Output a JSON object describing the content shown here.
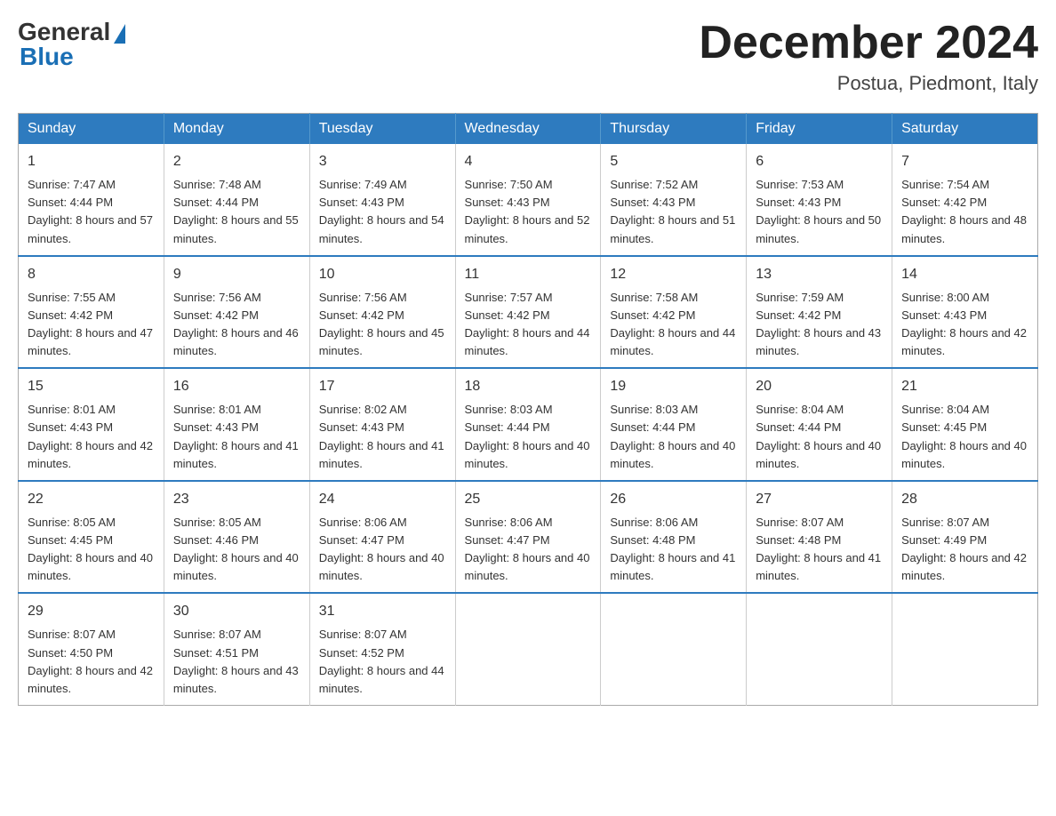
{
  "header": {
    "logo_general": "General",
    "logo_blue": "Blue",
    "month_title": "December 2024",
    "location": "Postua, Piedmont, Italy"
  },
  "calendar": {
    "days_of_week": [
      "Sunday",
      "Monday",
      "Tuesday",
      "Wednesday",
      "Thursday",
      "Friday",
      "Saturday"
    ],
    "weeks": [
      [
        {
          "day": "1",
          "sunrise": "7:47 AM",
          "sunset": "4:44 PM",
          "daylight": "8 hours and 57 minutes."
        },
        {
          "day": "2",
          "sunrise": "7:48 AM",
          "sunset": "4:44 PM",
          "daylight": "8 hours and 55 minutes."
        },
        {
          "day": "3",
          "sunrise": "7:49 AM",
          "sunset": "4:43 PM",
          "daylight": "8 hours and 54 minutes."
        },
        {
          "day": "4",
          "sunrise": "7:50 AM",
          "sunset": "4:43 PM",
          "daylight": "8 hours and 52 minutes."
        },
        {
          "day": "5",
          "sunrise": "7:52 AM",
          "sunset": "4:43 PM",
          "daylight": "8 hours and 51 minutes."
        },
        {
          "day": "6",
          "sunrise": "7:53 AM",
          "sunset": "4:43 PM",
          "daylight": "8 hours and 50 minutes."
        },
        {
          "day": "7",
          "sunrise": "7:54 AM",
          "sunset": "4:42 PM",
          "daylight": "8 hours and 48 minutes."
        }
      ],
      [
        {
          "day": "8",
          "sunrise": "7:55 AM",
          "sunset": "4:42 PM",
          "daylight": "8 hours and 47 minutes."
        },
        {
          "day": "9",
          "sunrise": "7:56 AM",
          "sunset": "4:42 PM",
          "daylight": "8 hours and 46 minutes."
        },
        {
          "day": "10",
          "sunrise": "7:56 AM",
          "sunset": "4:42 PM",
          "daylight": "8 hours and 45 minutes."
        },
        {
          "day": "11",
          "sunrise": "7:57 AM",
          "sunset": "4:42 PM",
          "daylight": "8 hours and 44 minutes."
        },
        {
          "day": "12",
          "sunrise": "7:58 AM",
          "sunset": "4:42 PM",
          "daylight": "8 hours and 44 minutes."
        },
        {
          "day": "13",
          "sunrise": "7:59 AM",
          "sunset": "4:42 PM",
          "daylight": "8 hours and 43 minutes."
        },
        {
          "day": "14",
          "sunrise": "8:00 AM",
          "sunset": "4:43 PM",
          "daylight": "8 hours and 42 minutes."
        }
      ],
      [
        {
          "day": "15",
          "sunrise": "8:01 AM",
          "sunset": "4:43 PM",
          "daylight": "8 hours and 42 minutes."
        },
        {
          "day": "16",
          "sunrise": "8:01 AM",
          "sunset": "4:43 PM",
          "daylight": "8 hours and 41 minutes."
        },
        {
          "day": "17",
          "sunrise": "8:02 AM",
          "sunset": "4:43 PM",
          "daylight": "8 hours and 41 minutes."
        },
        {
          "day": "18",
          "sunrise": "8:03 AM",
          "sunset": "4:44 PM",
          "daylight": "8 hours and 40 minutes."
        },
        {
          "day": "19",
          "sunrise": "8:03 AM",
          "sunset": "4:44 PM",
          "daylight": "8 hours and 40 minutes."
        },
        {
          "day": "20",
          "sunrise": "8:04 AM",
          "sunset": "4:44 PM",
          "daylight": "8 hours and 40 minutes."
        },
        {
          "day": "21",
          "sunrise": "8:04 AM",
          "sunset": "4:45 PM",
          "daylight": "8 hours and 40 minutes."
        }
      ],
      [
        {
          "day": "22",
          "sunrise": "8:05 AM",
          "sunset": "4:45 PM",
          "daylight": "8 hours and 40 minutes."
        },
        {
          "day": "23",
          "sunrise": "8:05 AM",
          "sunset": "4:46 PM",
          "daylight": "8 hours and 40 minutes."
        },
        {
          "day": "24",
          "sunrise": "8:06 AM",
          "sunset": "4:47 PM",
          "daylight": "8 hours and 40 minutes."
        },
        {
          "day": "25",
          "sunrise": "8:06 AM",
          "sunset": "4:47 PM",
          "daylight": "8 hours and 40 minutes."
        },
        {
          "day": "26",
          "sunrise": "8:06 AM",
          "sunset": "4:48 PM",
          "daylight": "8 hours and 41 minutes."
        },
        {
          "day": "27",
          "sunrise": "8:07 AM",
          "sunset": "4:48 PM",
          "daylight": "8 hours and 41 minutes."
        },
        {
          "day": "28",
          "sunrise": "8:07 AM",
          "sunset": "4:49 PM",
          "daylight": "8 hours and 42 minutes."
        }
      ],
      [
        {
          "day": "29",
          "sunrise": "8:07 AM",
          "sunset": "4:50 PM",
          "daylight": "8 hours and 42 minutes."
        },
        {
          "day": "30",
          "sunrise": "8:07 AM",
          "sunset": "4:51 PM",
          "daylight": "8 hours and 43 minutes."
        },
        {
          "day": "31",
          "sunrise": "8:07 AM",
          "sunset": "4:52 PM",
          "daylight": "8 hours and 44 minutes."
        },
        null,
        null,
        null,
        null
      ]
    ]
  }
}
